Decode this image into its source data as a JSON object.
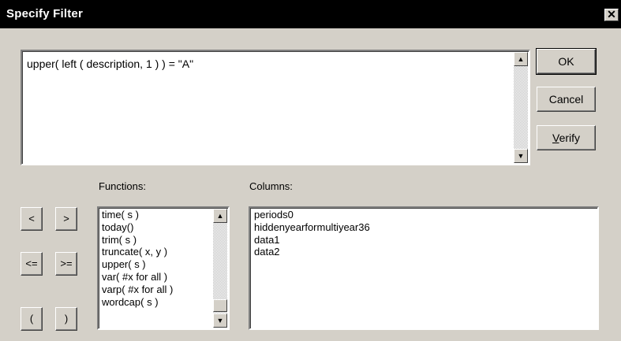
{
  "window": {
    "title": "Specify Filter",
    "close_glyph": "✕"
  },
  "expression": {
    "value": "upper( left ( description, 1 ) ) = \"A\""
  },
  "buttons": {
    "ok": "OK",
    "cancel": "Cancel",
    "verify_first": "V",
    "verify_rest": "erify"
  },
  "operators": {
    "lt": "<",
    "gt": ">",
    "lte": "<=",
    "gte": ">=",
    "lparen": "(",
    "rparen": ")"
  },
  "functions": {
    "label": "Functions:",
    "items": [
      "time( s )",
      "today()",
      "trim( s )",
      "truncate( x, y )",
      "upper( s )",
      "var( #x for all )",
      "varp( #x for all )",
      "wordcap( s )"
    ]
  },
  "columns": {
    "label": "Columns:",
    "items": [
      "periods0",
      "hiddenyearformultiyear36",
      "data1",
      "data2"
    ]
  },
  "icons": {
    "scroll_up": "▲",
    "scroll_down": "▼"
  }
}
